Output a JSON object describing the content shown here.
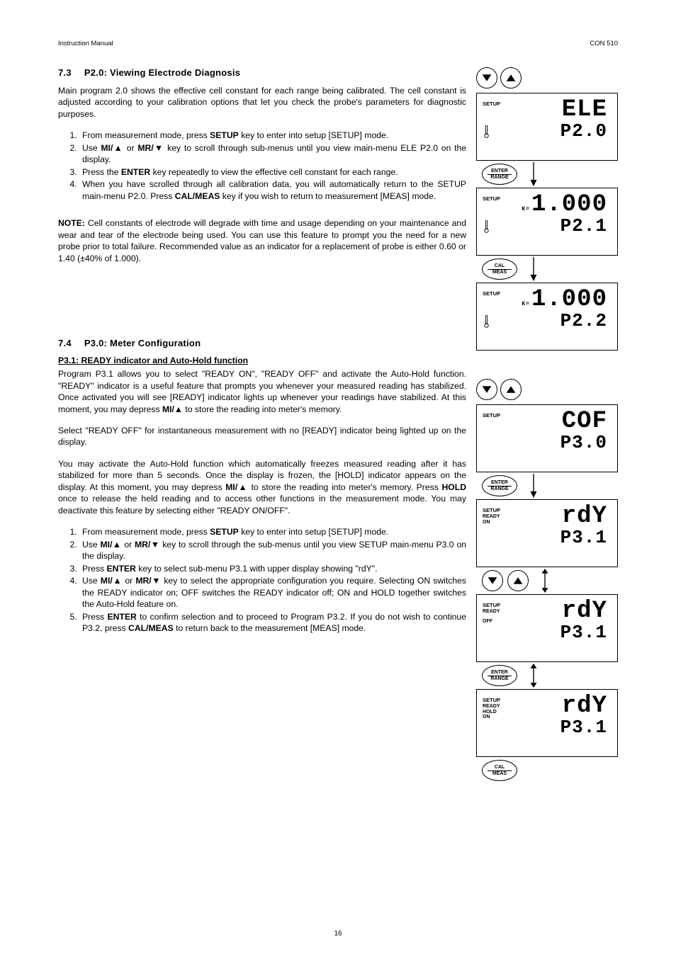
{
  "header": {
    "left": "Instruction Manual",
    "right": "CON 510"
  },
  "page_number": "16",
  "section73": {
    "number": "7.3",
    "title": "P2.0: Viewing Electrode Diagnosis",
    "intro": "Main program 2.0 shows the effective cell constant for each range being calibrated. The cell constant is adjusted according to your calibration options that let you check the probe's parameters for diagnostic purposes.",
    "steps": {
      "s1a": "From measurement mode, press ",
      "s1b": "SETUP",
      "s1c": " key to enter into setup [SETUP] mode.",
      "s2a": "Use ",
      "s2b": "MI/▲",
      "s2c": " or ",
      "s2d": "MR/▼",
      "s2e": " key to scroll through sub-menus until you view main-menu ELE P2.0 on the display.",
      "s3a": "Press the ",
      "s3b": "ENTER",
      "s3c": " key repeatedly to view the effective cell constant for each range.",
      "s4a": "When you have scrolled through all calibration data, you will automatically return to the SETUP main-menu P2.0. Press ",
      "s4b": "CAL/MEAS",
      "s4c": " key if you wish to return to measurement [MEAS] mode."
    },
    "note_label": "NOTE:",
    "note_body": " Cell constants of electrode will degrade with time and usage depending on your maintenance and wear and tear of the electrode being used. You can use this feature to prompt you the need for a new probe prior to total failure. Recommended value as an indicator for a replacement of probe is either 0.60 or 1.40 (±40% of 1.000)."
  },
  "section74": {
    "number": "7.4",
    "title": "P3.0: Meter Configuration",
    "sub": "P3.1: READY indicator and Auto-Hold function",
    "p1a": "Program P3.1 allows you to select \"READY ON\", \"READY OFF\" and activate the Auto-Hold function. \"READY\" indicator is a useful feature that prompts you whenever your measured reading has stabilized. Once activated you will see [READY] indicator lights up whenever your readings have stabilized. At this moment, you may depress ",
    "p1b": "MI/▲",
    "p1c": " to store the reading into meter's memory.",
    "p2": "Select \"READY OFF\" for instantaneous measurement with no [READY] indicator being lighted up on the display.",
    "p3a": "You may activate the Auto-Hold function which automatically freezes measured reading after it has stabilized for more than 5 seconds. Once the display is frozen, the [HOLD] indicator appears on the display. At this moment, you may depress ",
    "p3b": "MI/▲",
    "p3c": " to store the reading into meter's memory. Press ",
    "p3d": "HOLD",
    "p3e": " once to release the held reading and to access other functions in the measurement mode. You may deactivate this feature by selecting either \"READY ON/OFF\".",
    "steps": {
      "s1a": "From measurement mode, press ",
      "s1b": "SETUP",
      "s1c": " key to enter into setup [SETUP] mode.",
      "s2a": "Use ",
      "s2b": "MI/▲",
      "s2c": " or ",
      "s2d": "MR/▼",
      "s2e": " key to scroll through the sub-menus until you view SETUP main-menu P3.0 on the display.",
      "s3a": "Press ",
      "s3b": "ENTER",
      "s3c": " key to select sub-menu P3.1 with upper display showing \"rdY\".",
      "s4a": "Use ",
      "s4b": "MI/▲",
      "s4c": " or ",
      "s4d": "MR/▼",
      "s4e": " key to select the appropriate configuration you require. Selecting ON switches the READY indicator on; OFF switches the READY indicator off; ON and HOLD together switches the Auto-Hold feature on.",
      "s5a": "Press ",
      "s5b": "ENTER",
      "s5c": " to confirm selection and to proceed to Program P3.2. If you do not wish to continue P3.2, press ",
      "s5d": "CAL/MEAS",
      "s5e": " to return back to the measurement [MEAS] mode."
    }
  },
  "fig": {
    "setup": "SETUP",
    "enter": "ENTER",
    "range": "RANGE",
    "cal": "CAL",
    "meas": "MEAS",
    "ready": "READY",
    "hold": "HOLD",
    "on": "ON",
    "off": "OFF",
    "k_eq": "K=",
    "ele": "ELE",
    "p20": "P2.0",
    "v1000": "1.000",
    "p21": "P2.1",
    "p22": "P2.2",
    "cof": "COF",
    "p30": "P3.0",
    "rdy": "rdY",
    "p31": "P3.1"
  }
}
